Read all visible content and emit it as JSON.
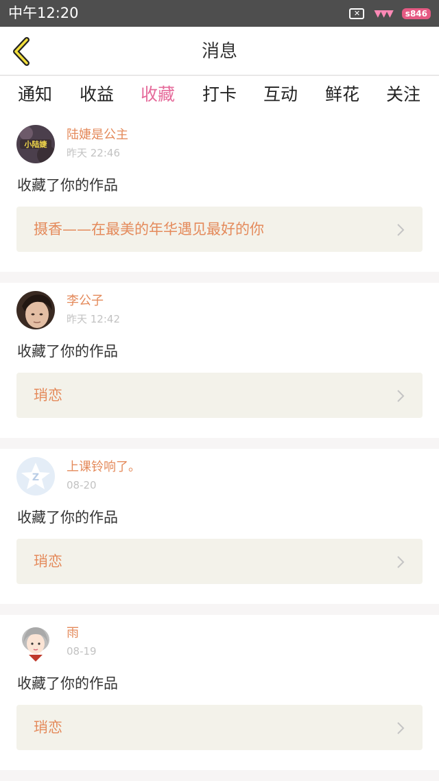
{
  "status_bar": {
    "time": "中午12:20",
    "icons": [
      "close-box-icon",
      "signal-icon",
      "battery-icon"
    ],
    "close_glyph": "✕",
    "signal_glyph": "▼▼▼",
    "battery_label": "s846"
  },
  "header": {
    "back_icon": "chevron-left-icon",
    "title": "消息"
  },
  "tabs": [
    {
      "label": "通知",
      "active": false
    },
    {
      "label": "收益",
      "active": false
    },
    {
      "label": "收藏",
      "active": true
    },
    {
      "label": "打卡",
      "active": false
    },
    {
      "label": "互动",
      "active": false
    },
    {
      "label": "鲜花",
      "active": false
    },
    {
      "label": "关注",
      "active": false
    }
  ],
  "colors": {
    "accent_pink": "#e56a9a",
    "username_orange": "#e48a5b",
    "link_background": "#f3f2ea"
  },
  "feed": [
    {
      "username": "陆婕是公主",
      "time": "昨天 22:46",
      "action": "收藏了你的作品",
      "work": "摄香——在最美的年华遇见最好的你",
      "avatar_badge": "小陆婕"
    },
    {
      "username": "李公子",
      "time": "昨天 12:42",
      "action": "收藏了你的作品",
      "work": "琑恋"
    },
    {
      "username": "上课铃响了。",
      "time": "08-20",
      "action": "收藏了你的作品",
      "work": "琑恋"
    },
    {
      "username": "雨",
      "time": "08-19",
      "action": "收藏了你的作品",
      "work": "琑恋"
    }
  ]
}
